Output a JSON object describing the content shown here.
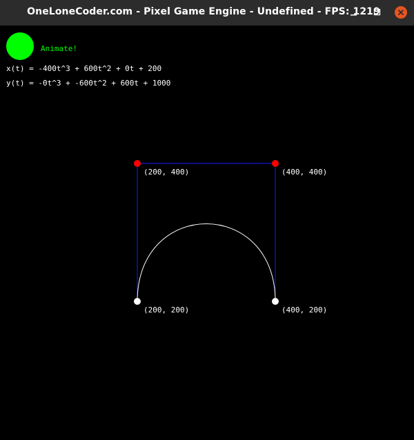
{
  "window": {
    "title": "OneLoneCoder.com - Pixel Game Engine - Undefined - FPS: 1219",
    "minimize_icon": "minimize-icon",
    "maximize_icon": "maximize-icon",
    "close_icon": "close-icon",
    "close_color": "#e95420",
    "titlebar_color": "#2c2c2c"
  },
  "hud": {
    "animate_label": "Animate!",
    "animate_color": "#00ff00",
    "equation_x": "x(t) = -400t^3 + 600t^2 + 0t + 200",
    "equation_y": "y(t) = -0t^3 + -600t^2 + 600t + 1000"
  },
  "scene": {
    "control_polygon_color": "#1a1aff",
    "curve_color": "#ffffff",
    "endpoint_color": "#ffffff",
    "control_point_color": "#ff0000",
    "points": [
      {
        "label": "(200, 200)",
        "kind": "endpoint"
      },
      {
        "label": "(200, 400)",
        "kind": "control"
      },
      {
        "label": "(400, 400)",
        "kind": "control"
      },
      {
        "label": "(400, 200)",
        "kind": "endpoint"
      }
    ]
  }
}
